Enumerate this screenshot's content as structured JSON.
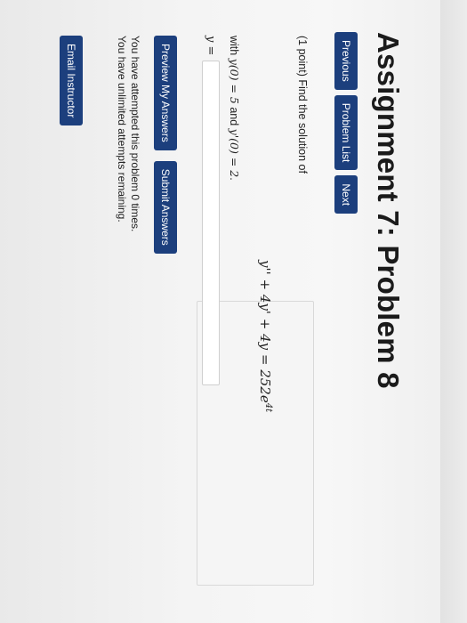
{
  "page": {
    "title": "Assignment 7: Problem 8"
  },
  "nav": {
    "previous": "Previous",
    "problem_list": "Problem List",
    "next": "Next"
  },
  "problem": {
    "intro": "(1 point) Find the solution of",
    "equation": "y'' + 4y' + 4y = 252e",
    "equation_exp": "4t",
    "conditions_prefix": "with ",
    "cond1": "y(0) = 5",
    "conditions_and": " and ",
    "cond2": "y'(0) = 2",
    "conditions_suffix": ".",
    "answer_label": "y =",
    "answer_value": ""
  },
  "actions": {
    "preview": "Preview My Answers",
    "submit": "Submit Answers"
  },
  "status": {
    "attempts": "You have attempted this problem 0 times.",
    "remaining": "You have unlimited attempts remaining."
  },
  "footer": {
    "email_instructor": "Email Instructor"
  },
  "colors": {
    "button_bg": "#1c3f7d",
    "button_text": "#ffffff"
  }
}
